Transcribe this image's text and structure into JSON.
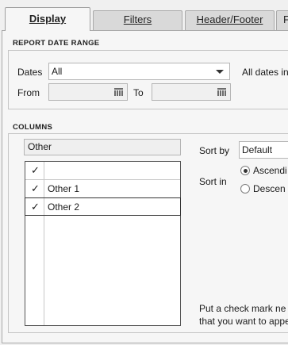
{
  "tabs": [
    {
      "label": "Display",
      "active": true
    },
    {
      "label": "Filters"
    },
    {
      "label": "Header/Footer"
    },
    {
      "label": "F"
    }
  ],
  "report_date_range": {
    "title": "REPORT DATE RANGE",
    "dates_label": "Dates",
    "dates_value": "All",
    "dates_note": "All dates in",
    "from_label": "From",
    "from_value": "",
    "to_label": "To",
    "to_value": ""
  },
  "columns": {
    "title": "COLUMNS",
    "search_value": "Other",
    "items": [
      {
        "checked": true,
        "label": ""
      },
      {
        "checked": true,
        "label": "Other 1"
      },
      {
        "checked": true,
        "label": "Other 2"
      }
    ],
    "check_glyph": "✓",
    "sort_by_label": "Sort by",
    "sort_by_value": "Default",
    "sort_in_label": "Sort in",
    "sort_options": [
      "Ascendi",
      "Descen"
    ],
    "sort_selected": "Ascendi",
    "help_line1": "Put a check mark ne",
    "help_line2": "that you want to appe"
  }
}
